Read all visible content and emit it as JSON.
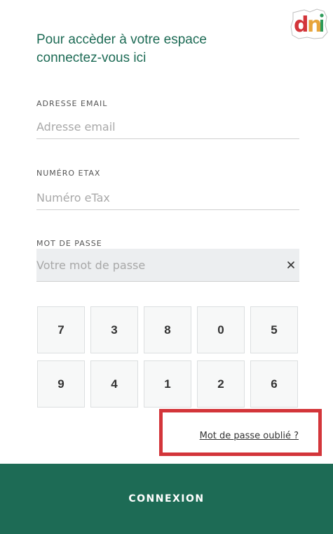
{
  "logo": {
    "text": "dni"
  },
  "title": "Pour accèder à votre espace connectez-vous ici",
  "email": {
    "label": "ADRESSE EMAIL",
    "placeholder": "Adresse email"
  },
  "etax": {
    "label": "NUMÉRO ETAX",
    "placeholder": "Numéro eTax"
  },
  "password": {
    "label": "MOT DE PASSE",
    "placeholder": "Votre mot de passe",
    "clear_icon": "close-icon"
  },
  "keypad": {
    "row1": [
      "7",
      "3",
      "8",
      "0",
      "5"
    ],
    "row2": [
      "9",
      "4",
      "1",
      "2",
      "6"
    ]
  },
  "forgot": "Mot de passe oublié ?",
  "submit": "CONNEXION",
  "colors": {
    "brand": "#1d6b55",
    "highlight": "#d3353a"
  }
}
